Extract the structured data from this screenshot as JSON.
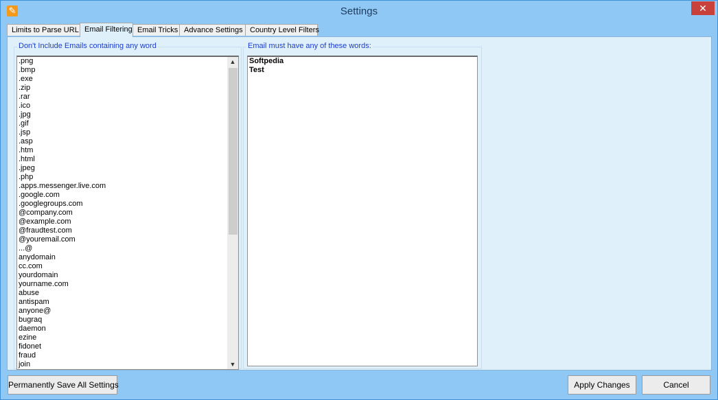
{
  "window": {
    "title": "Settings"
  },
  "title_bar": {
    "app_icon": "wrench-icon",
    "close_label": "✕",
    "close_icon": "close-icon"
  },
  "tabs": [
    {
      "label": "Limits to Parse URL",
      "active": false
    },
    {
      "label": "Email Filtering",
      "active": true
    },
    {
      "label": "Email Tricks",
      "active": false
    },
    {
      "label": "Advance Settings",
      "active": false
    },
    {
      "label": "Country Level Filters",
      "active": false
    }
  ],
  "exclude_group": {
    "title": "Don't Include Emails containing any word",
    "items": [
      ".png",
      ".bmp",
      ".exe",
      ".zip",
      ".rar",
      ".ico",
      ".jpg",
      ".gif",
      ".jsp",
      ".asp",
      ".htm",
      ".html",
      ".jpeg",
      ".php",
      ".apps.messenger.live.com",
      ".google.com",
      ".googlegroups.com",
      "@company.com",
      "@example.com",
      "@fraudtest.com",
      "@youremail.com",
      "...@",
      "anydomain",
      "cc.com",
      "yourdomain",
      "yourname.com",
      "abuse",
      "antispam",
      "anyone@",
      "bugraq",
      "daemon",
      "ezine",
      "fidonet",
      "fraud",
      "join"
    ]
  },
  "include_group": {
    "title": "Email must have any of these words:",
    "items": [
      "Softpedia",
      "Test"
    ]
  },
  "buttons": {
    "save_all": "Permanently Save All Settings",
    "apply": "Apply Changes",
    "cancel": "Cancel"
  },
  "scrollbar": {
    "up_icon": "▲",
    "down_icon": "▼"
  },
  "colors": {
    "titlebar": "#8fc7f5",
    "panel": "#dff0fb",
    "group_title": "#1a3ccf",
    "close": "#c8413a"
  }
}
